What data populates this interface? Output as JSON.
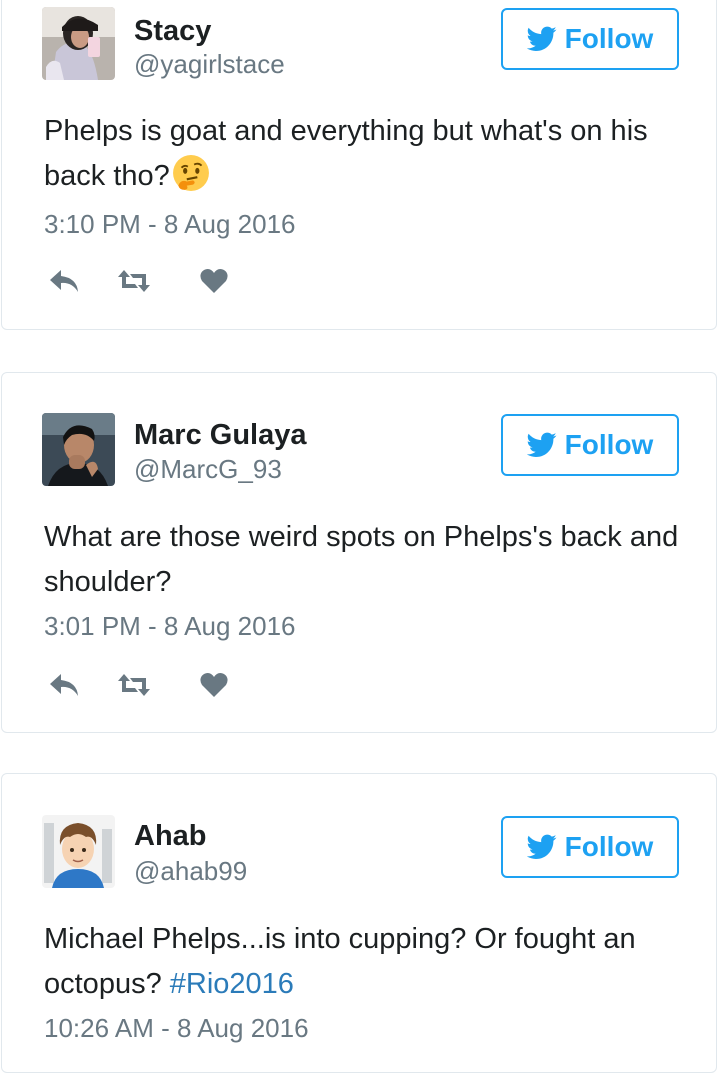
{
  "colors": {
    "accent": "#1da1f2",
    "text": "#1c2022",
    "muted": "#697882",
    "icon": "#697882",
    "hashtag": "#2b7bb9",
    "border": "#e1e8ed"
  },
  "follow_label": "Follow",
  "tweets": [
    {
      "name": "Stacy",
      "handle": "@yagirlstace",
      "text": "Phelps is goat and everything but what's on his back tho?",
      "emoji": "thinking-face-emoji",
      "timestamp": "3:10 PM - 8 Aug 2016",
      "actions": [
        "reply-icon",
        "retweet-icon",
        "like-icon"
      ]
    },
    {
      "name": "Marc Gulaya",
      "handle": "@MarcG_93",
      "text": "What are those weird spots on Phelps's back and shoulder?",
      "timestamp": "3:01 PM - 8 Aug 2016",
      "actions": [
        "reply-icon",
        "retweet-icon",
        "like-icon"
      ]
    },
    {
      "name": "Ahab",
      "handle": "@ahab99",
      "text": "Michael Phelps...is into cupping? Or fought an octopus?",
      "hashtag": "#Rio2016",
      "timestamp": "10:26 AM - 8 Aug 2016"
    }
  ]
}
